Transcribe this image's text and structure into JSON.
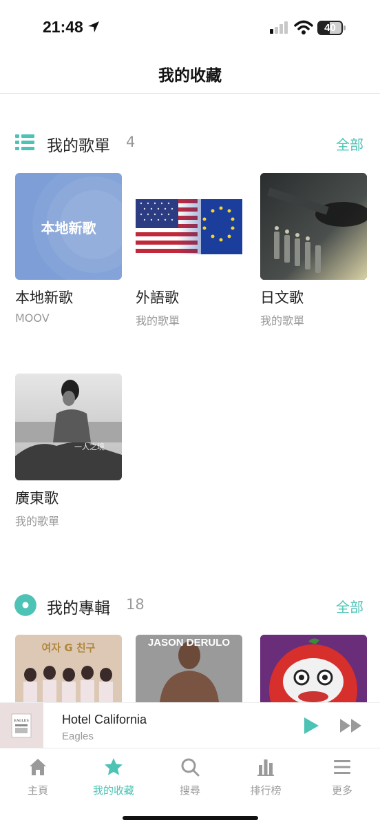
{
  "status": {
    "time": "21:48",
    "battery": "40"
  },
  "header": {
    "title": "我的收藏"
  },
  "playlists": {
    "title": "我的歌單",
    "count": "4",
    "see_all": "全部",
    "items": [
      {
        "cover_text": "本地新歌",
        "title": "本地新歌",
        "subtitle": "MOOV"
      },
      {
        "title": "外語歌",
        "subtitle": "我的歌單"
      },
      {
        "title": "日文歌",
        "subtitle": "我的歌單"
      },
      {
        "title": "廣東歌",
        "subtitle": "我的歌單"
      }
    ]
  },
  "albums": {
    "title": "我的專輯",
    "count": "18",
    "see_all": "全部",
    "items": [
      {
        "cover_text": "여자 G 친구"
      },
      {
        "cover_text": "JASON DERULO"
      },
      {
        "cover_text": ""
      }
    ]
  },
  "player": {
    "track": "Hotel California",
    "artist": "Eagles",
    "cover_text": "EAGLES"
  },
  "tabs": [
    {
      "label": "主頁",
      "icon": "home-icon"
    },
    {
      "label": "我的收藏",
      "icon": "star-icon",
      "active": true
    },
    {
      "label": "搜尋",
      "icon": "search-icon"
    },
    {
      "label": "排行榜",
      "icon": "chart-icon"
    },
    {
      "label": "更多",
      "icon": "menu-icon"
    }
  ],
  "colors": {
    "accent": "#4cc3b5",
    "muted": "#999999"
  }
}
